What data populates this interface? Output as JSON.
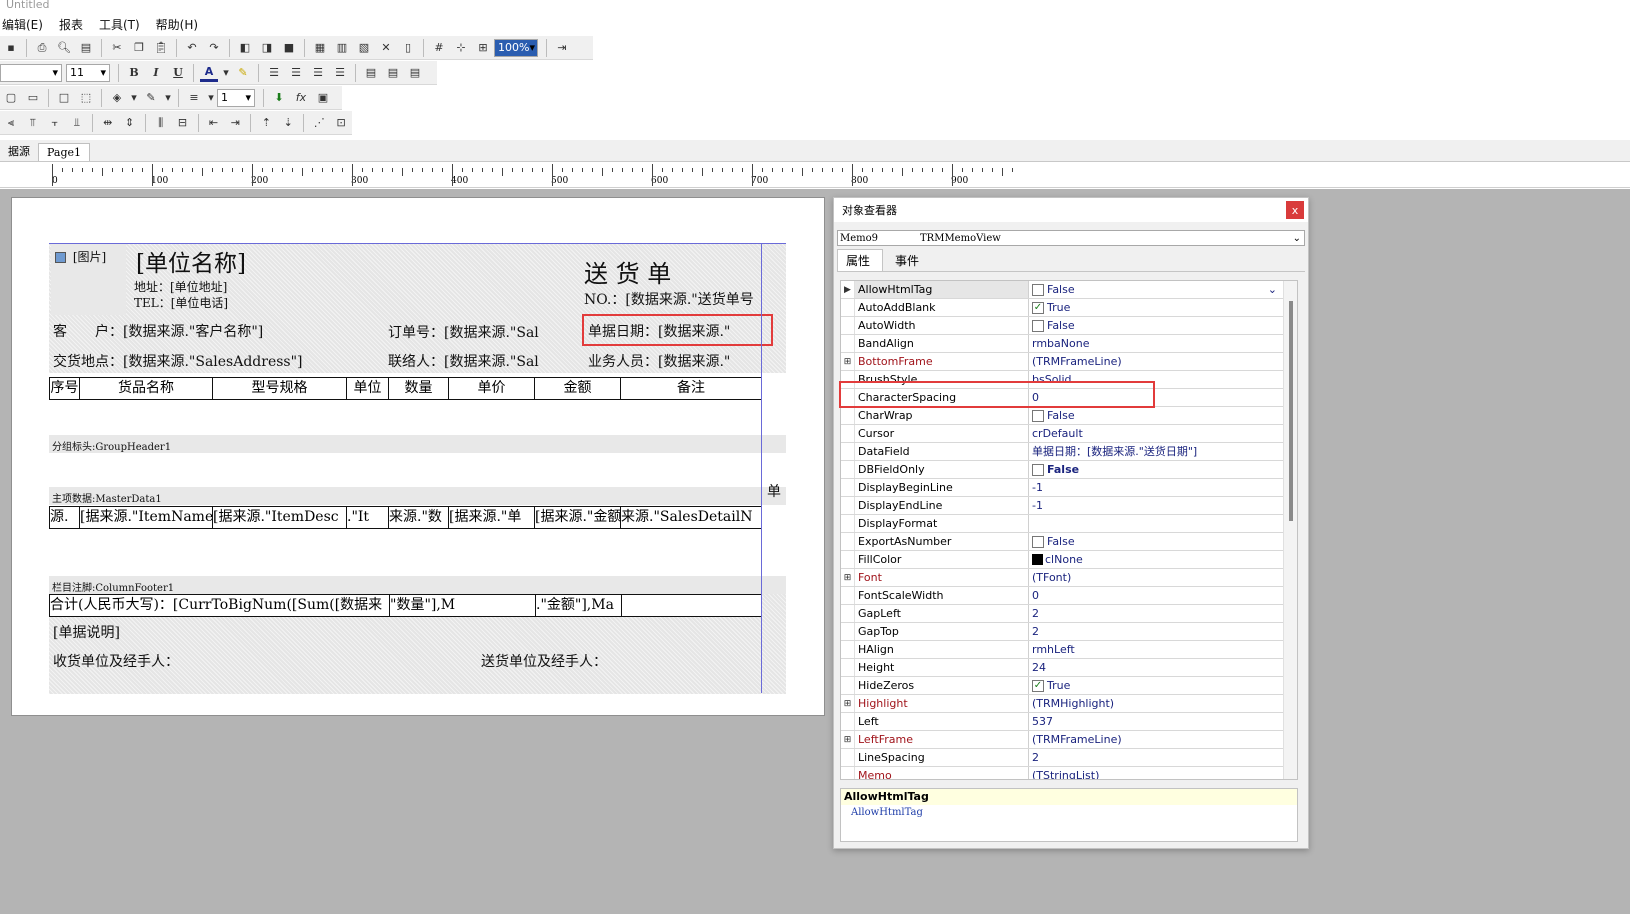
{
  "window": {
    "title": "Untitled"
  },
  "menu": {
    "items": [
      "编辑(E)",
      "报表",
      "工具(T)",
      "帮助(H)"
    ]
  },
  "toolbar": {
    "font_size": "11",
    "zoom": "100%",
    "line_width": "1",
    "bold_label": "B",
    "italic_label": "I",
    "underline_label": "U",
    "font_color_label": "A"
  },
  "tabs": {
    "left": "据源",
    "page": "Page1"
  },
  "ruler": {
    "labels": [
      "0",
      "100",
      "200",
      "300",
      "400",
      "500",
      "600",
      "700",
      "800",
      "900"
    ]
  },
  "report": {
    "image_label": "[图片]",
    "company_name": "[单位名称]",
    "company_address": "地址：[单位地址]",
    "company_tel": "TEL：[单位电话]",
    "doc_title": "送 货 单",
    "doc_no": "NO.：[数据来源.\"送货单号",
    "customer": "客　　户：[数据来源.\"客户名称\"]",
    "order_no": "订单号：[数据来源.\"Sal",
    "doc_date": "单据日期：[数据来源.\"",
    "delivery_address": "交货地点：[数据来源.\"SalesAddress\"]",
    "contact": "联络人：[数据来源.\"Sal",
    "salesperson": "业务人员：[数据来源.\"",
    "columns": [
      "序号",
      "货品名称",
      "型号规格",
      "单位",
      "数量",
      "单价",
      "金额",
      "备注"
    ],
    "band_group_header": "分组标头:GroupHeader1",
    "band_master_data": "主项数据:MasterData1",
    "master_cells": [
      "源.",
      "[据来源.\"ItemName",
      "[据来源.\"ItemDesc",
      ".\"It",
      "来源.\"数",
      "[据来源.\"单",
      "[据来源.\"金额",
      "来源.\"SalesDetailN"
    ],
    "side_text": "单",
    "band_column_footer": "栏目注脚:ColumnFooter1",
    "total_text": "合计(人民币大写)：[CurrToBigNum([Sum([数据来",
    "total_qty": "\"数量\"],M",
    "total_amount": ".\"金额\"],Ma",
    "remark": "[单据说明]",
    "receiver_sign": "收货单位及经手人：",
    "sender_sign": "送货单位及经手人："
  },
  "inspector": {
    "title": "对象查看器",
    "close_label": "x",
    "object_name": "Memo9",
    "object_type": "TRMMemoView",
    "tab_properties": "属性",
    "tab_events": "事件",
    "properties": [
      {
        "name": "AllowHtmlTag",
        "value": "False",
        "check": false,
        "expand": "arrow",
        "dropdown": true
      },
      {
        "name": "AutoAddBlank",
        "value": "True",
        "check": true
      },
      {
        "name": "AutoWidth",
        "value": "False",
        "check": false
      },
      {
        "name": "BandAlign",
        "value": "rmbaNone"
      },
      {
        "name": "BottomFrame",
        "value": "(TRMFrameLine)",
        "red": true,
        "expand": "plus"
      },
      {
        "name": "BrushStyle",
        "value": "bsSolid"
      },
      {
        "name": "CharacterSpacing",
        "value": "0"
      },
      {
        "name": "CharWrap",
        "value": "False",
        "check": false
      },
      {
        "name": "Cursor",
        "value": "crDefault"
      },
      {
        "name": "DataField",
        "value": "单据日期：[数据来源.\"送货日期\"]"
      },
      {
        "name": "DBFieldOnly",
        "value": "False",
        "check": false,
        "bold": true
      },
      {
        "name": "DisplayBeginLine",
        "value": "-1"
      },
      {
        "name": "DisplayEndLine",
        "value": "-1"
      },
      {
        "name": "DisplayFormat",
        "value": ""
      },
      {
        "name": "ExportAsNumber",
        "value": "False",
        "check": false
      },
      {
        "name": "FillColor",
        "value": "clNone",
        "swatch": "#000000"
      },
      {
        "name": "Font",
        "value": "(TFont)",
        "red": true,
        "expand": "plus"
      },
      {
        "name": "FontScaleWidth",
        "value": "0"
      },
      {
        "name": "GapLeft",
        "value": "2"
      },
      {
        "name": "GapTop",
        "value": "2"
      },
      {
        "name": "HAlign",
        "value": "rmhLeft"
      },
      {
        "name": "Height",
        "value": "24"
      },
      {
        "name": "HideZeros",
        "value": "True",
        "check": true
      },
      {
        "name": "Highlight",
        "value": "(TRMHighlight)",
        "red": true,
        "expand": "plus"
      },
      {
        "name": "Left",
        "value": "537"
      },
      {
        "name": "LeftFrame",
        "value": "(TRMFrameLine)",
        "red": true,
        "expand": "plus"
      },
      {
        "name": "LineSpacing",
        "value": "2"
      },
      {
        "name": "Memo",
        "value": "(TStringList)",
        "red": true
      }
    ],
    "help_title": "AllowHtmlTag",
    "help_desc": "AllowHtmlTag"
  },
  "colors": {
    "highlight_border": "#e23b3b",
    "workspace_bg": "#b4b4b4",
    "property_value": "#1a237e",
    "property_object": "#a0141b"
  }
}
